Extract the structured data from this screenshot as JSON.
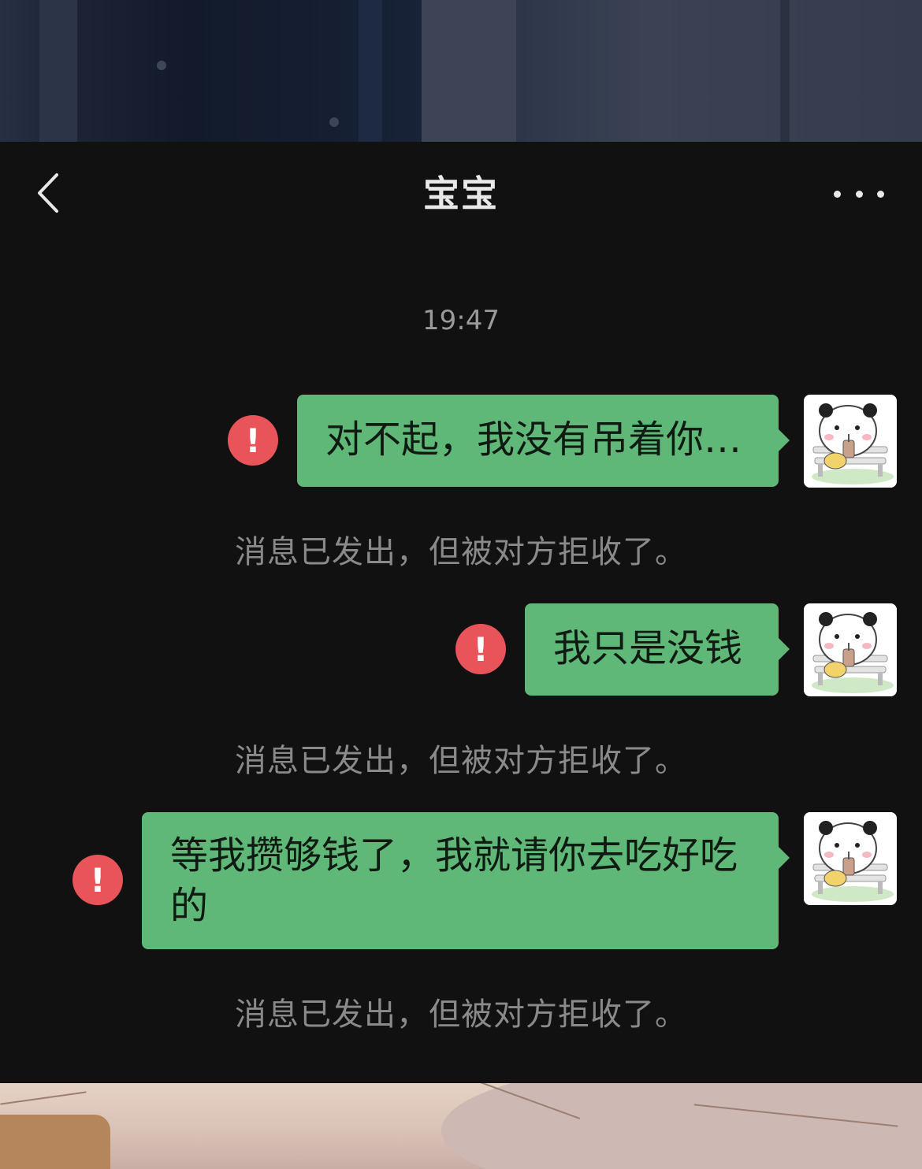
{
  "header": {
    "title": "宝宝",
    "back_icon": "chevron-left-icon",
    "more_icon": "more-horizontal-icon"
  },
  "timestamp": "19:47",
  "messages": [
    {
      "text": "对不起，我没有吊着你…",
      "status_icon": "error-icon",
      "status_symbol": "!",
      "notice": "消息已发出，但被对方拒收了。"
    },
    {
      "text": "我只是没钱",
      "status_icon": "error-icon",
      "status_symbol": "!",
      "notice": "消息已发出，但被对方拒收了。"
    },
    {
      "text": "等我攒够钱了，我就请你去吃好吃的",
      "status_icon": "error-icon",
      "status_symbol": "!",
      "notice": "消息已发出，但被对方拒收了。"
    }
  ],
  "colors": {
    "bubble": "#5fb878",
    "error": "#e8545a",
    "background": "#111111",
    "notice_text": "#8a8a8a"
  }
}
